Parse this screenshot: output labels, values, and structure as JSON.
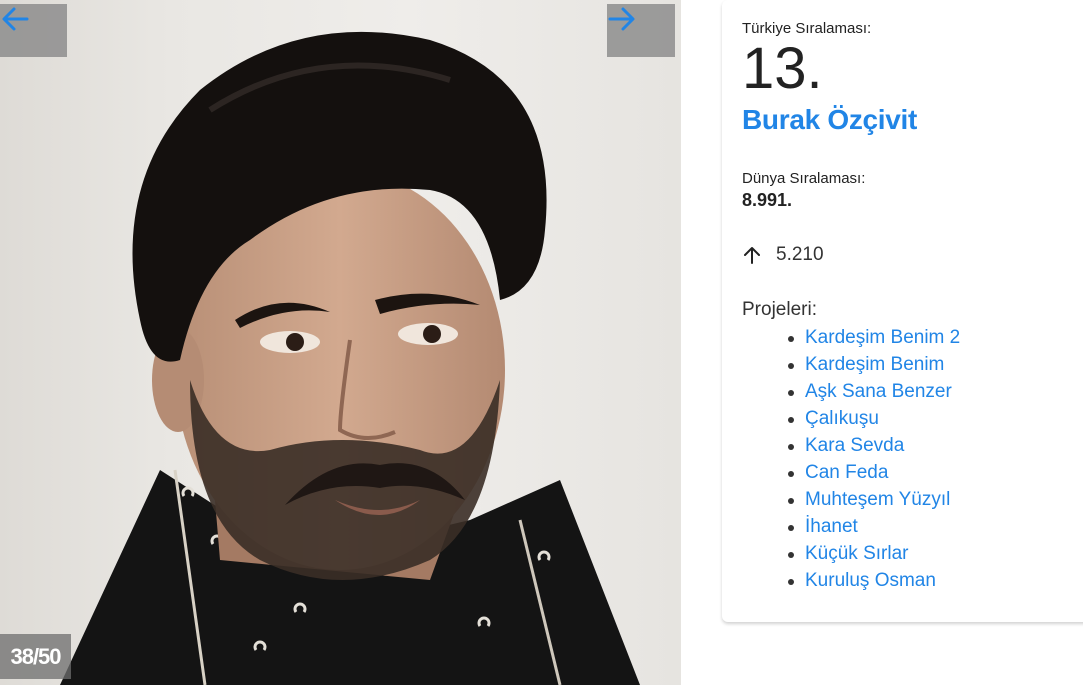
{
  "gallery": {
    "counter": "38/50",
    "prev_icon": "arrow-left-icon",
    "next_icon": "arrow-right-icon",
    "accent": "#2185e6"
  },
  "info": {
    "turkey_rank_label": "Türkiye Sıralaması:",
    "turkey_rank": "13.",
    "name": "Burak Özçivit",
    "world_rank_label": "Dünya Sıralaması:",
    "world_rank": "8.991.",
    "change_icon": "arrow-up-icon",
    "change_value": "5.210",
    "projects_label": "Projeleri:",
    "projects": [
      "Kardeşim Benim 2",
      "Kardeşim Benim",
      "Aşk Sana Benzer",
      "Çalıkuşu",
      "Kara Sevda",
      "Can Feda",
      "Muhteşem Yüzyıl",
      "İhanet",
      "Küçük Sırlar",
      "Kuruluş Osman"
    ]
  }
}
